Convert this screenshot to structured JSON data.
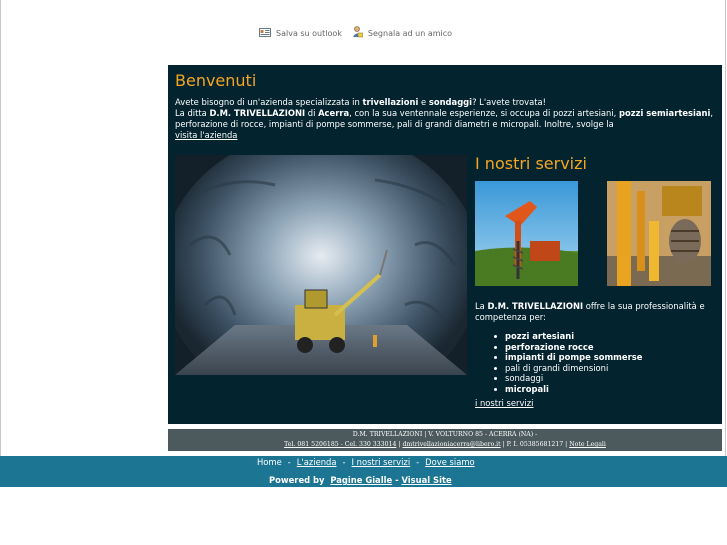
{
  "toolbar": {
    "save_outlook": "Salva su outlook",
    "tell_friend": "Segnala ad un amico"
  },
  "welcome": {
    "title": "Benvenuti",
    "line1_a": "Avete bisogno di un'azienda specializzata in ",
    "line1_b": "trivellazioni",
    "line1_c": " e ",
    "line1_d": "sondaggi",
    "line1_e": "? L'avete trovata!",
    "line2_a": "La ditta ",
    "line2_b": "D.M. TRIVELLAZIONI",
    "line2_c": " di ",
    "line2_d": "Acerra",
    "line2_e": ", con la sua ventennale esperienze, si occupa di pozzi artesiani, ",
    "line2_f": "pozzi semiartesiani",
    "line2_g": ", perforazione di rocce, impianti di pompe sommerse, pali di grandi diametri e micropali. Inoltre, svolge la ",
    "visit_link": "visita l'azienda"
  },
  "services": {
    "title": "I nostri servizi",
    "desc_a": "La ",
    "desc_b": "D.M. TRIVELLAZIONI",
    "desc_c": " offre la sua professionalità e competenza per:",
    "items": [
      {
        "label": "pozzi artesiani",
        "bold": true
      },
      {
        "label": "perforazione rocce",
        "bold": true
      },
      {
        "label": "impianti di pompe sommerse",
        "bold": true
      },
      {
        "label": "pali di grandi dimensioni",
        "bold": false
      },
      {
        "label": "sondaggi",
        "bold": false
      },
      {
        "label": "micropali",
        "bold": true
      }
    ],
    "link": "i nostri servizi"
  },
  "footer": {
    "line1": "D.M. TRIVELLAZIONI | V. VOLTURNO 85 - ACERRA (NA) -",
    "tel": "Tel. 081 5206185 - Cel. 330 333014",
    "sep1": " | ",
    "email": "dmtrivellazioniacerra@libero.it",
    "piva": " | P. I. 05385681217 | ",
    "note": "Note Legali"
  },
  "nav": {
    "home": "Home",
    "sep": "-",
    "azienda": "L'azienda",
    "servizi": "I nostri servizi",
    "dove": "Dove siamo"
  },
  "powered": {
    "prefix": "Powered by",
    "pagine": "Pagine Gialle",
    "dash": "-",
    "visual": "Visual Site"
  },
  "colors": {
    "main_bg": "#03232f",
    "title_orange": "#f5a623",
    "nav_blue": "#1b7593",
    "footer_gray": "#4c5a5e"
  }
}
